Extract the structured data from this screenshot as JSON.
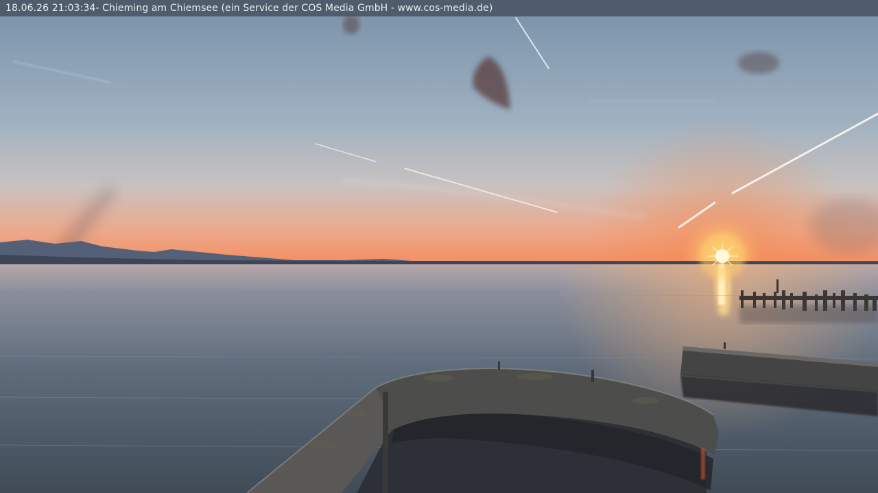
{
  "caption": {
    "datetime": "18.06.26 21:03:34",
    "text": " - Chieming am Chiemsee (ein Service der COS Media GmbH - www.cos-media.de)"
  },
  "scene": {
    "subject": "webcam-view-lake-sunset",
    "colors": {
      "sky_top": "#7f95ab",
      "sky_horizon": "#f2936a",
      "sun": "#fff3b0",
      "water": "#4f5d6c",
      "wall": "#4a4c4a"
    }
  }
}
